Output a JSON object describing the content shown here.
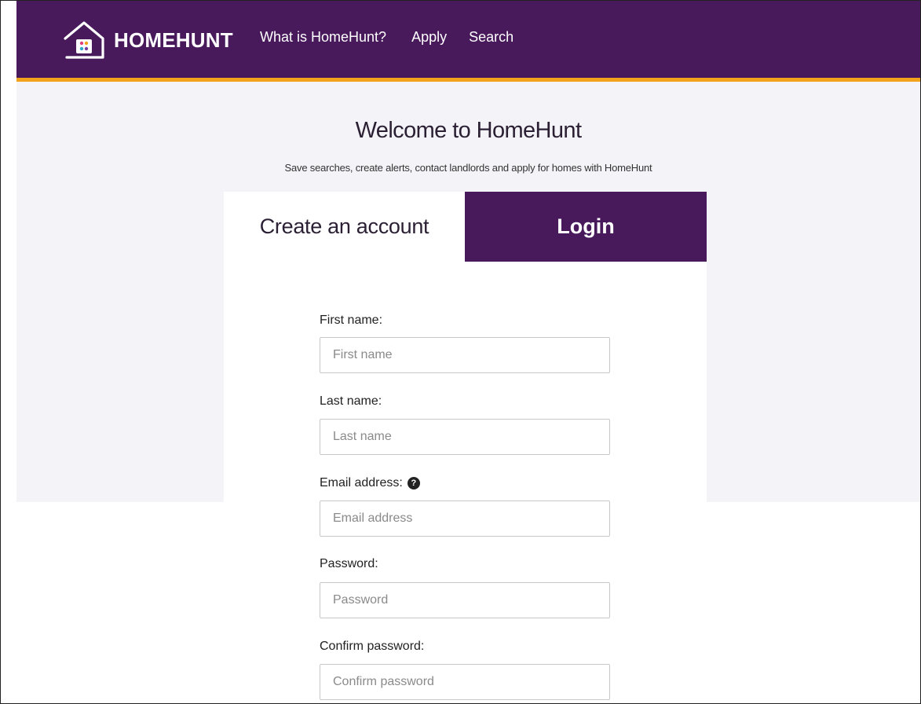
{
  "header": {
    "brand": "HOMEHUNT",
    "nav": [
      {
        "label": "What is HomeHunt?"
      },
      {
        "label": "Apply"
      },
      {
        "label": "Search"
      }
    ],
    "colors": {
      "background": "#481a5c",
      "accent_border": "#f2a21b"
    }
  },
  "hero": {
    "title": "Welcome to HomeHunt",
    "subtitle": "Save searches, create alerts, contact landlords and apply for homes with HomeHunt"
  },
  "tabs": {
    "create_label": "Create an account",
    "login_label": "Login",
    "active": "Create an account"
  },
  "form": {
    "first_name": {
      "label": "First name:",
      "placeholder": "First name",
      "value": ""
    },
    "last_name": {
      "label": "Last name:",
      "placeholder": "Last name",
      "value": ""
    },
    "email": {
      "label": "Email address:",
      "placeholder": "Email address",
      "value": "",
      "help_icon": "question-circle-icon"
    },
    "password": {
      "label": "Password:",
      "placeholder": "Password",
      "value": ""
    },
    "confirm_password": {
      "label": "Confirm password:",
      "placeholder": "Confirm password",
      "value": ""
    }
  }
}
